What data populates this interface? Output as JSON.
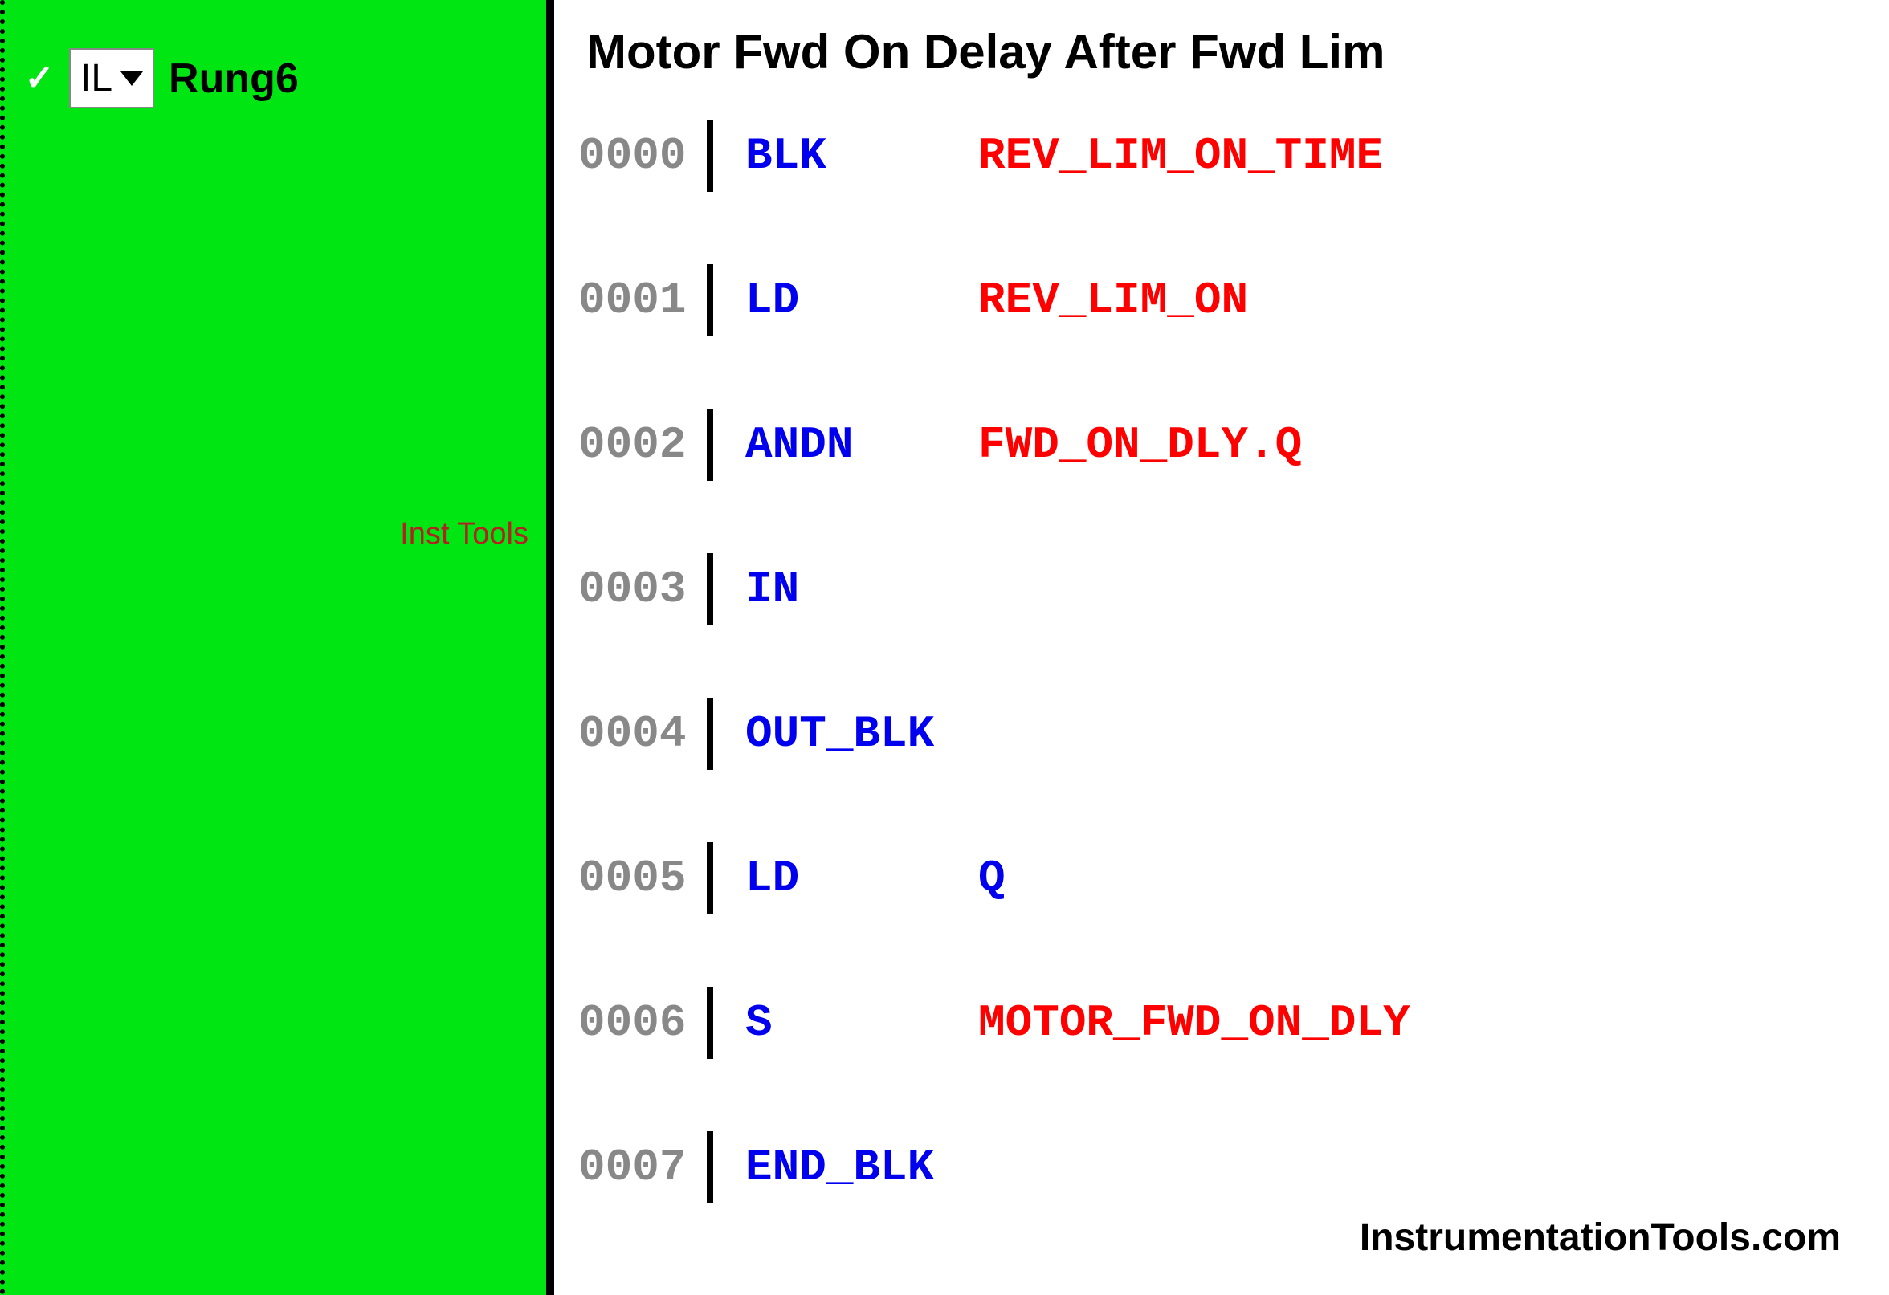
{
  "sidebar": {
    "check_symbol": "✓",
    "language_selector": "IL",
    "rung_label": "Rung6",
    "watermark": "Inst Tools"
  },
  "code": {
    "title": "Motor Fwd On Delay After Fwd Lim",
    "lines": [
      {
        "num": "0000",
        "opcode": "BLK",
        "operand": "REV_LIM_ON_TIME",
        "operand_color": "red"
      },
      {
        "num": "0001",
        "opcode": "LD",
        "operand": "REV_LIM_ON",
        "operand_color": "red"
      },
      {
        "num": "0002",
        "opcode": "ANDN",
        "operand": "FWD_ON_DLY.Q",
        "operand_color": "red"
      },
      {
        "num": "0003",
        "opcode": "IN",
        "operand": "",
        "operand_color": ""
      },
      {
        "num": "0004",
        "opcode": "OUT_BLK",
        "operand": "",
        "operand_color": ""
      },
      {
        "num": "0005",
        "opcode": "LD",
        "operand": "Q",
        "operand_color": "blue"
      },
      {
        "num": "0006",
        "opcode": "S",
        "operand": "MOTOR_FWD_ON_DLY",
        "operand_color": "red"
      },
      {
        "num": "0007",
        "opcode": "END_BLK",
        "operand": "",
        "operand_color": ""
      }
    ]
  },
  "footer": {
    "credit": "InstrumentationTools.com"
  }
}
